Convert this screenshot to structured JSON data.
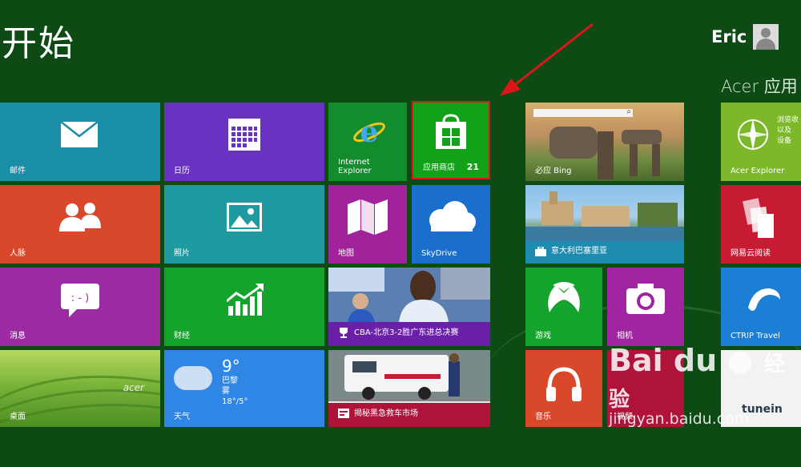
{
  "header": {
    "title": "开始",
    "user_name": "Eric",
    "group_title": "Acer 应用"
  },
  "tiles": {
    "mail": "邮件",
    "calendar": "日历",
    "ie": "Internet Explorer",
    "store": "应用商店",
    "store_badge": "21",
    "bing": "必应 Bing",
    "people": "人脉",
    "photos": "照片",
    "maps": "地图",
    "skydrive": "SkyDrive",
    "travel": "意大利巴塞里亚",
    "messaging": "消息",
    "finance": "财经",
    "sports_news": "CBA-北京3-2胜广东进总决赛",
    "games": "游戏",
    "camera": "相机",
    "desktop": "桌面",
    "weather": "天气",
    "weather_temp": "9°",
    "weather_city": "巴黎",
    "weather_cond": "雾",
    "weather_range": "18°/5°",
    "news2": "揭秘黑急救车市场",
    "music": "音乐",
    "video": "视频",
    "acer_explorer": "Acer Explorer",
    "acer_desc_1": "浏览收",
    "acer_desc_2": "以及",
    "acer_desc_3": "设备",
    "netease": "网易云阅读",
    "ctrip": "CTRIP Travel",
    "tunein": "tunein",
    "acer_logo": "acer"
  },
  "watermark": {
    "logo": "Bai  du",
    "logo_suffix": "经验",
    "url": "jingyan.baidu.com"
  },
  "colors": {
    "background": "#0d4a14",
    "mail": "#1a8ea6",
    "calendar": "#6a32c0",
    "ie": "#138c2e",
    "store": "#11a21a",
    "people": "#d9482a",
    "photos": "#1e9aa0",
    "maps": "#a1229a",
    "skydrive": "#1b6fcc",
    "messaging": "#9c2aa3",
    "finance": "#14a32c",
    "games": "#14a32c",
    "camera": "#a125a0",
    "music": "#d9482a",
    "video": "#b0133a",
    "weather": "#2f86e4",
    "acer_explorer": "#7cb82a",
    "netease": "#c61b33",
    "ctrip": "#1b7fd6",
    "highlight": "#e0151b"
  }
}
